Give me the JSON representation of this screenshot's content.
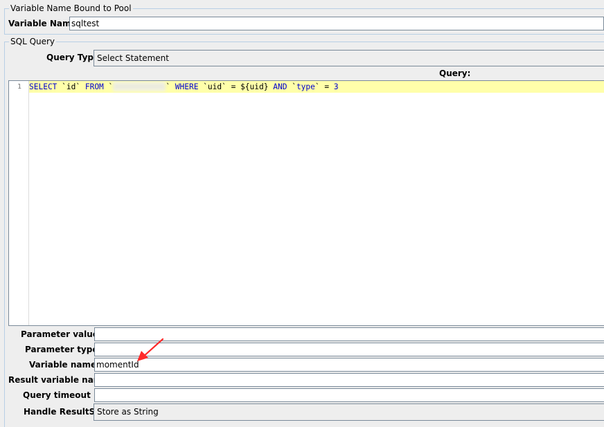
{
  "pool_section": {
    "title": "Variable Name Bound to Pool",
    "variable_name_label": "Variable Name:",
    "variable_name_value": "sqltest"
  },
  "sql_section": {
    "title": "SQL Query",
    "query_type_label": "Query Type:",
    "query_type_value": "Select Statement",
    "query_header": "Query:",
    "line_number": "1",
    "code": {
      "kw_select": "SELECT",
      "t1": " `id` ",
      "kw_from": "FROM",
      "t2": " `",
      "t3": "` ",
      "kw_where": "WHERE",
      "t4": " `uid` = ${uid} ",
      "kw_and": "AND",
      "t5": " `",
      "kw_type": "type",
      "t6": "` = ",
      "num_3": "3"
    }
  },
  "params": {
    "parameter_values_label": "Parameter values:",
    "parameter_values_value": "",
    "parameter_types_label": "Parameter types:",
    "parameter_types_value": "",
    "variable_names_label": "Variable names:",
    "variable_names_value": "momentId",
    "result_variable_name_label": "Result variable name:",
    "result_variable_name_value": "",
    "query_timeout_label": "Query timeout (s):",
    "query_timeout_value": "",
    "handle_resultset_label": "Handle ResultSet:",
    "handle_resultset_value": "Store as String"
  },
  "colors": {
    "background": "#eeeeee",
    "group_border": "#b8cfe5",
    "current_line": "#ffffaa",
    "keyword": "#0000cc",
    "annotation_arrow": "#ff2a2a"
  }
}
